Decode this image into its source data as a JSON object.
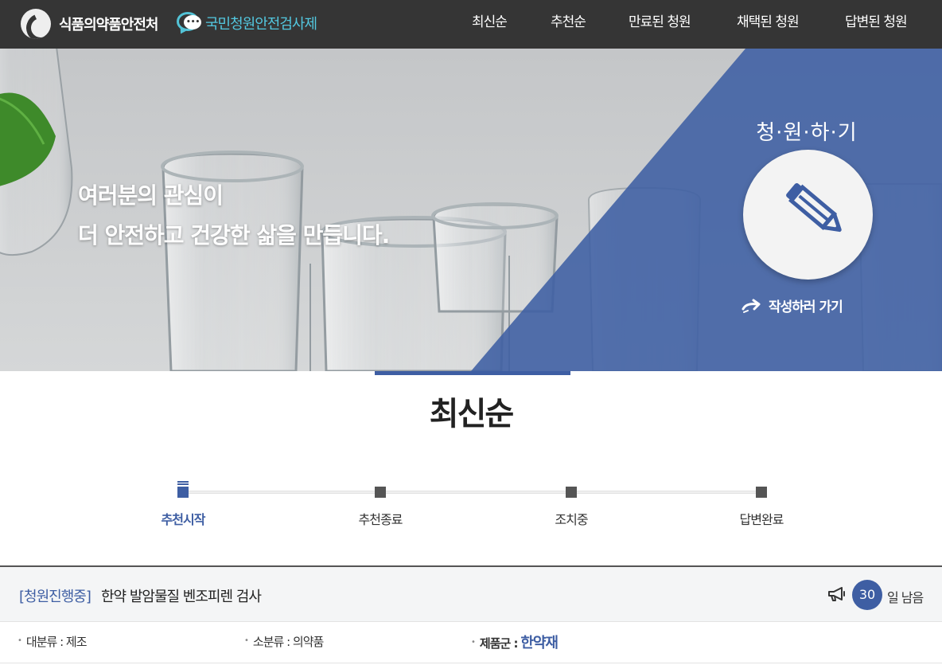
{
  "header": {
    "org_name": "식품의약품안전처",
    "service_name": "국민청원안전검사제",
    "nav": [
      "최신순",
      "추천순",
      "만료된 청원",
      "채택된 청원",
      "답변된 청원"
    ]
  },
  "hero": {
    "slogan_line1": "여러분의 관심이",
    "slogan_line2": "더 안전하고 건강한 삶을 만듭니다.",
    "write_title": "청·원·하·기",
    "write_link": "작성하러 가기"
  },
  "section": {
    "title": "최신순"
  },
  "steps": [
    {
      "label": "추천시작",
      "active": true
    },
    {
      "label": "추천종료",
      "active": false
    },
    {
      "label": "조치중",
      "active": false
    },
    {
      "label": "답변완료",
      "active": false
    }
  ],
  "petition": {
    "status": "[청원진행중]",
    "title": "한약 발암물질 벤조피렌 검사",
    "days_left": "30",
    "days_suffix": "일 남음",
    "major_category": "대분류 : 제조",
    "minor_category": "소분류 : 의약품",
    "product_group_label": "제품군 :",
    "product_group_value": "한약재"
  },
  "colors": {
    "accent": "#3e5ea3",
    "header_bg": "#353535",
    "brand_cyan": "#53c8e0"
  },
  "icons": {
    "logo": "government-logo-icon",
    "brand": "speech-bubble-icon",
    "write": "pencil-icon",
    "write_link": "arrow-icon",
    "days": "megaphone-icon"
  }
}
